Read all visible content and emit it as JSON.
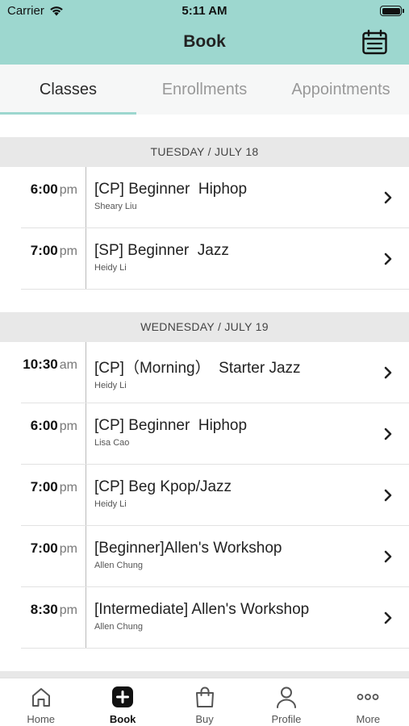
{
  "status_bar": {
    "carrier": "Carrier",
    "time": "5:11 AM"
  },
  "nav": {
    "title": "Book",
    "right_icon": "calendar-icon"
  },
  "tabs": [
    {
      "label": "Classes",
      "active": true
    },
    {
      "label": "Enrollments",
      "active": false
    },
    {
      "label": "Appointments",
      "active": false
    }
  ],
  "days": [
    {
      "label": "TUESDAY / JULY 18",
      "classes": [
        {
          "time": "6:00",
          "ampm": "pm",
          "name": "[CP] Beginner  Hiphop",
          "instructor": "Sheary Liu"
        },
        {
          "time": "7:00",
          "ampm": "pm",
          "name": "[SP] Beginner  Jazz",
          "instructor": "Heidy Li"
        }
      ]
    },
    {
      "label": "WEDNESDAY / JULY 19",
      "classes": [
        {
          "time": "10:30",
          "ampm": "am",
          "name": "[CP]（Morning）  Starter Jazz",
          "instructor": "Heidy Li"
        },
        {
          "time": "6:00",
          "ampm": "pm",
          "name": "[CP] Beginner  Hiphop",
          "instructor": "Lisa Cao"
        },
        {
          "time": "7:00",
          "ampm": "pm",
          "name": "[CP] Beg Kpop/Jazz",
          "instructor": "Heidy Li"
        },
        {
          "time": "7:00",
          "ampm": "pm",
          "name": "[Beginner]Allen's Workshop",
          "instructor": "Allen Chung"
        },
        {
          "time": "8:30",
          "ampm": "pm",
          "name": "[Intermediate] Allen's Workshop",
          "instructor": "Allen Chung"
        }
      ]
    }
  ],
  "tabbar": [
    {
      "label": "Home",
      "icon": "home-icon",
      "active": false
    },
    {
      "label": "Book",
      "icon": "book-plus-icon",
      "active": true
    },
    {
      "label": "Buy",
      "icon": "shopping-bag-icon",
      "active": false
    },
    {
      "label": "Profile",
      "icon": "profile-icon",
      "active": false
    },
    {
      "label": "More",
      "icon": "more-icon",
      "active": false
    }
  ],
  "colors": {
    "accent": "#9dd7cf",
    "day_header_bg": "#e8e8e8"
  }
}
